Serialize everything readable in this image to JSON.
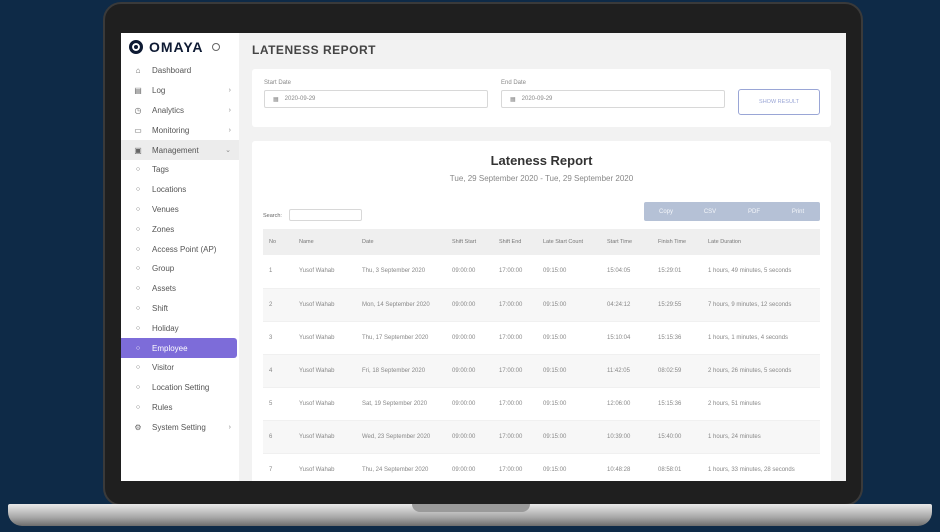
{
  "brand": {
    "name": "OMAYA"
  },
  "sidebar": {
    "items": [
      {
        "label": "Dashboard",
        "icon": "home-icon",
        "chevron": ""
      },
      {
        "label": "Log",
        "icon": "log-icon",
        "chevron": "›"
      },
      {
        "label": "Analytics",
        "icon": "clock-icon",
        "chevron": "›"
      },
      {
        "label": "Monitoring",
        "icon": "monitor-icon",
        "chevron": "›"
      },
      {
        "label": "Management",
        "icon": "management-icon",
        "chevron": "⌄"
      },
      {
        "label": "Tags",
        "icon": "circle-icon",
        "chevron": ""
      },
      {
        "label": "Locations",
        "icon": "circle-icon",
        "chevron": ""
      },
      {
        "label": "Venues",
        "icon": "circle-icon",
        "chevron": ""
      },
      {
        "label": "Zones",
        "icon": "circle-icon",
        "chevron": ""
      },
      {
        "label": "Access Point (AP)",
        "icon": "circle-icon",
        "chevron": ""
      },
      {
        "label": "Group",
        "icon": "circle-icon",
        "chevron": ""
      },
      {
        "label": "Assets",
        "icon": "circle-icon",
        "chevron": ""
      },
      {
        "label": "Shift",
        "icon": "circle-icon",
        "chevron": ""
      },
      {
        "label": "Holiday",
        "icon": "circle-icon",
        "chevron": ""
      },
      {
        "label": "Employee",
        "icon": "circle-icon",
        "chevron": ""
      },
      {
        "label": "Visitor",
        "icon": "circle-icon",
        "chevron": ""
      },
      {
        "label": "Location Setting",
        "icon": "circle-icon",
        "chevron": ""
      },
      {
        "label": "Rules",
        "icon": "circle-icon",
        "chevron": ""
      },
      {
        "label": "System Setting",
        "icon": "gear-icon",
        "chevron": "›"
      }
    ]
  },
  "header": {
    "title": "LATENESS REPORT"
  },
  "filters": {
    "start_label": "Start Date",
    "start_value": "2020-09-29",
    "end_label": "End Date",
    "end_value": "2020-09-29",
    "show_button": "SHOW RESULT"
  },
  "report": {
    "title": "Lateness Report",
    "subtitle": "Tue, 29 September 2020 - Tue, 29 September 2020",
    "export_buttons": [
      "Copy",
      "CSV",
      "PDF",
      "Print"
    ],
    "search_label": "Search:",
    "columns": [
      "No",
      "Name",
      "Date",
      "Shift Start",
      "Shift End",
      "Late Start Count",
      "Start Time",
      "Finish Time",
      "Late Duration"
    ],
    "rows": [
      [
        "1",
        "Yusof Wahab",
        "Thu, 3 September 2020",
        "09:00:00",
        "17:00:00",
        "09:15:00",
        "15:04:05",
        "15:29:01",
        "1 hours, 49 minutes, 5 seconds"
      ],
      [
        "2",
        "Yusof Wahab",
        "Mon, 14 September 2020",
        "09:00:00",
        "17:00:00",
        "09:15:00",
        "04:24:12",
        "15:29:55",
        "7 hours, 9 minutes, 12 seconds"
      ],
      [
        "3",
        "Yusof Wahab",
        "Thu, 17 September 2020",
        "09:00:00",
        "17:00:00",
        "09:15:00",
        "15:10:04",
        "15:15:36",
        "1 hours, 1 minutes, 4 seconds"
      ],
      [
        "4",
        "Yusof Wahab",
        "Fri, 18 September 2020",
        "09:00:00",
        "17:00:00",
        "09:15:00",
        "11:42:05",
        "08:02:59",
        "2 hours, 26 minutes, 5 seconds"
      ],
      [
        "5",
        "Yusof Wahab",
        "Sat, 19 September 2020",
        "09:00:00",
        "17:00:00",
        "09:15:00",
        "12:06:00",
        "15:15:36",
        "2 hours, 51 minutes"
      ],
      [
        "6",
        "Yusof Wahab",
        "Wed, 23 September 2020",
        "09:00:00",
        "17:00:00",
        "09:15:00",
        "10:39:00",
        "15:40:00",
        "1 hours, 24 minutes"
      ],
      [
        "7",
        "Yusof Wahab",
        "Thu, 24 September 2020",
        "09:00:00",
        "17:00:00",
        "09:15:00",
        "10:48:28",
        "08:58:01",
        "1 hours, 33 minutes, 28 seconds"
      ]
    ]
  },
  "colors": {
    "background": "#0e2a47",
    "active_item": "#7d6cd9",
    "export_bar": "#b5c1d6"
  }
}
